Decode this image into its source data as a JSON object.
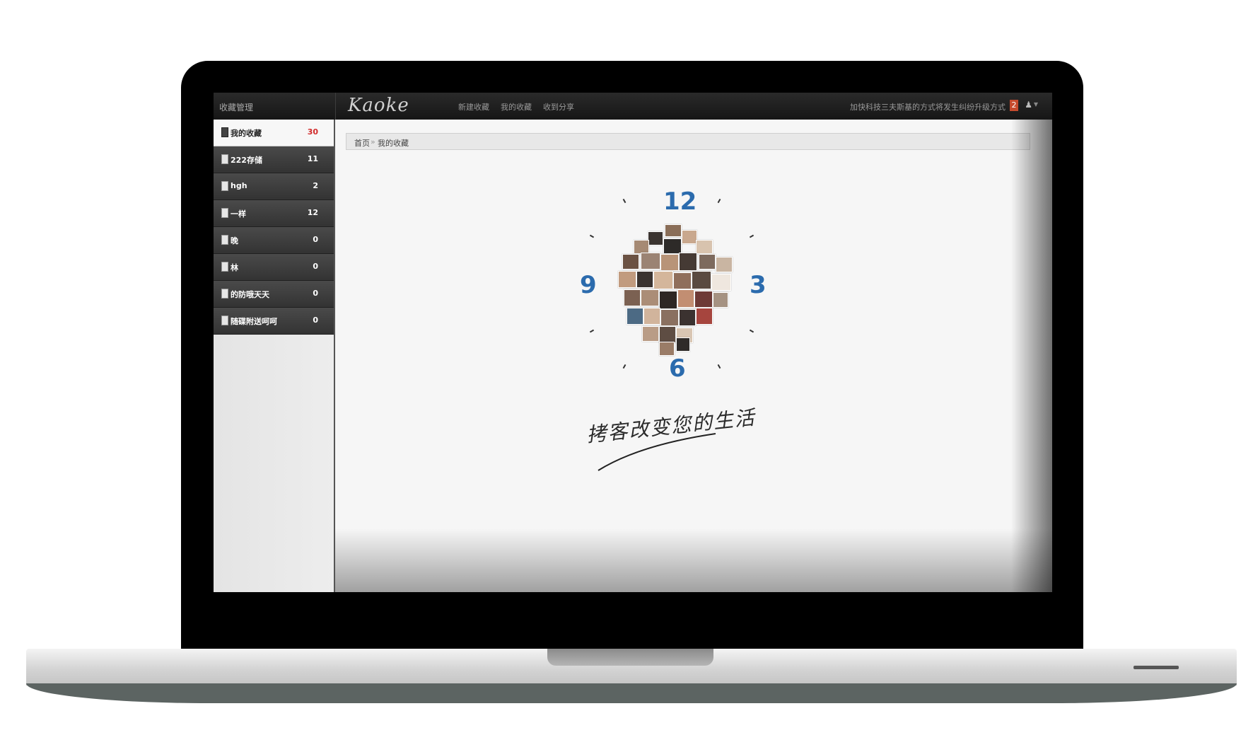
{
  "topbar": {
    "section_title": "收藏管理",
    "logo": "Kaoke",
    "nav": [
      "新建收藏",
      "我的收藏",
      "收到分享"
    ],
    "notice": "加快科技三夫斯基的方式将发生纠纷升级方式",
    "badge_count": "2",
    "user_icon": "user-icon",
    "caret_icon": "caret-down-icon"
  },
  "sidebar": {
    "items": [
      {
        "label": "我的收藏",
        "count": "30",
        "active": true
      },
      {
        "label": "222存储",
        "count": "11"
      },
      {
        "label": "hgh",
        "count": "2"
      },
      {
        "label": "一样",
        "count": "12"
      },
      {
        "label": "晚",
        "count": "0"
      },
      {
        "label": "林",
        "count": "0"
      },
      {
        "label": "的防哦天天",
        "count": "0"
      },
      {
        "label": "随碟附送呵呵",
        "count": "0"
      }
    ]
  },
  "breadcrumb": {
    "home": "首页",
    "separator": "»",
    "current": "我的收藏"
  },
  "clock": {
    "numbers": {
      "n12": "12",
      "n3": "3",
      "n6": "6",
      "n9": "9"
    }
  },
  "slogan": "拷客改变您的生活",
  "colors": {
    "accent": "#2b6bad",
    "badge": "#c54a2d",
    "count_active": "#d12b2b",
    "topbar": "#1c1c1c"
  }
}
